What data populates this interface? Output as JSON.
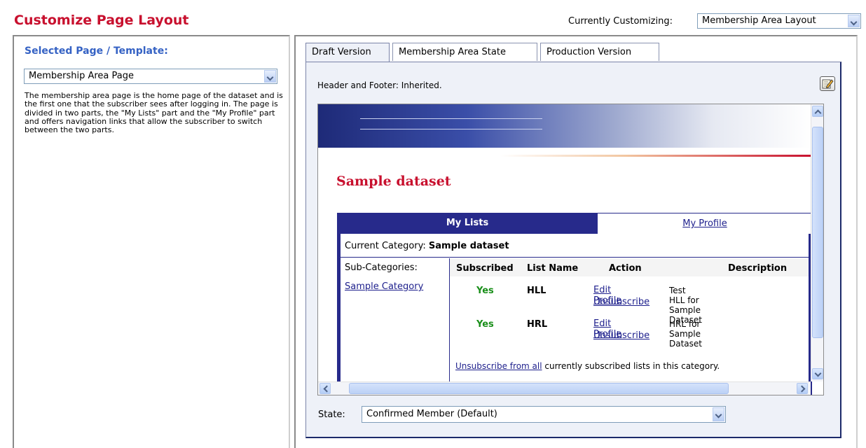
{
  "header": {
    "title": "Customize Page Layout",
    "customizing_label": "Currently Customizing:",
    "customizing_value": "Membership Area Layout"
  },
  "left_panel": {
    "heading": "Selected Page / Template:",
    "selected_page": "Membership Area Page",
    "description": "The membership area page is the home page of the dataset and is the first one that the subscriber sees after logging in. The page is divided in two parts, the \"My Lists\" part and the \"My Profile\" part and offers navigation links that allow the subscriber to switch between the two parts."
  },
  "tabs": [
    {
      "label": "Draft Version",
      "active": true
    },
    {
      "label": "Membership Area State",
      "active": false
    },
    {
      "label": "Production Version",
      "active": false
    }
  ],
  "draft": {
    "header_footer_text": "Header and Footer: Inherited.",
    "state_label": "State:",
    "state_value": "Confirmed Member (Default)"
  },
  "preview": {
    "dataset_title": "Sample dataset",
    "tab_my_lists": "My Lists",
    "tab_my_profile": "My Profile",
    "current_category_label": "Current Category:",
    "current_category_value": "Sample dataset",
    "subcategories_label": "Sub-Categories:",
    "subcategory_link": "Sample Category",
    "columns": {
      "subscribed": "Subscribed",
      "list_name": "List Name",
      "action": "Action",
      "description": "Description"
    },
    "rows": [
      {
        "subscribed": "Yes",
        "list_name": "HLL",
        "edit": "Edit Profile",
        "unsubscribe": "Unsubscribe",
        "description": "Test HLL for Sample Dataset"
      },
      {
        "subscribed": "Yes",
        "list_name": "HRL",
        "edit": "Edit Profile",
        "unsubscribe": "Unsubscribe",
        "description": "HRL for Sample Dataset"
      }
    ],
    "unsubscribe_all_link": "Unsubscribe from all",
    "unsubscribe_all_suffix": " currently subscribed lists in this category."
  },
  "colors": {
    "title_red": "#c8102e",
    "heading_blue": "#3562c4",
    "nav_blue": "#272a8b",
    "yes_green": "#1a8f1a",
    "panel_bg": "#eef1f8"
  },
  "icons": {
    "edit": "edit-pencil-icon"
  }
}
